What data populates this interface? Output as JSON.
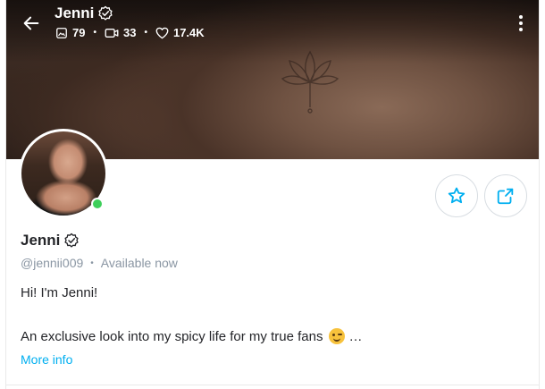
{
  "header": {
    "name": "Jenni",
    "stats": {
      "photos": "79",
      "videos": "33",
      "likes": "17.4K"
    }
  },
  "profile": {
    "name": "Jenni",
    "username": "@jennii009",
    "status": "Available now",
    "bio_line1": "Hi! I'm Jenni!",
    "bio_line2": "An exclusive look into my spicy life for my true fans",
    "bio_ellipsis": "…",
    "more_info": "More info"
  },
  "icons": {
    "back": "arrow-left-icon",
    "verified": "verified-badge-icon",
    "photos": "image-icon",
    "videos": "video-icon",
    "likes": "heart-icon",
    "more": "more-vertical-icon",
    "favorite": "star-icon",
    "share": "share-icon",
    "emoji": "winking-face-icon"
  },
  "colors": {
    "accent": "#00aff0",
    "online": "#3ecf5a",
    "text": "#242529",
    "muted": "#8a96a3"
  }
}
